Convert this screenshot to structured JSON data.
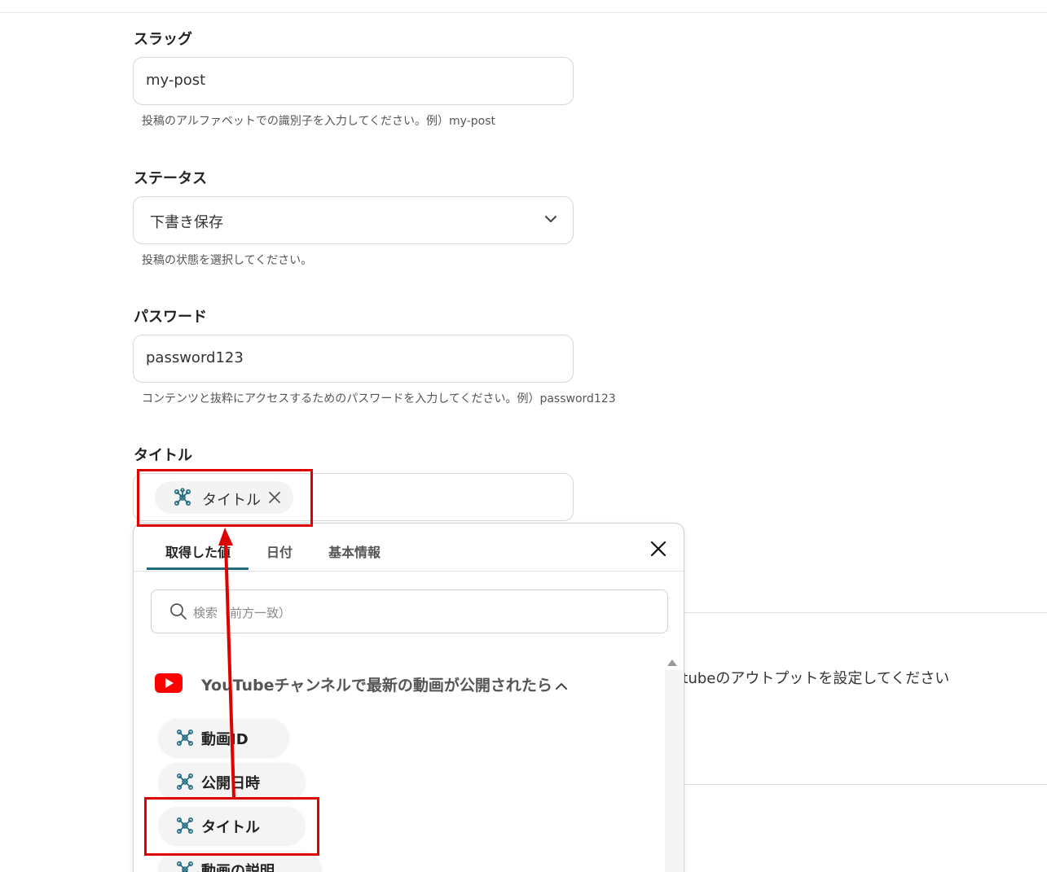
{
  "form": {
    "slug": {
      "label": "スラッグ",
      "value": "my-post",
      "helper": "投稿のアルファベットでの識別子を入力してください。例）my-post"
    },
    "status": {
      "label": "ステータス",
      "value": "下書き保存",
      "helper": "投稿の状態を選択してください。"
    },
    "password": {
      "label": "パスワード",
      "value": "password123",
      "helper": "コンテンツと抜粋にアクセスするためのパスワードを入力してください。例）password123"
    },
    "title": {
      "label": "タイトル",
      "chip": "タイトル"
    }
  },
  "picker": {
    "tabs": [
      "取得した値",
      "日付",
      "基本情報"
    ],
    "active_tab": "取得した値",
    "search_placeholder": "検索（前方一致）",
    "section": "YouTubeチャンネルで最新の動画が公開されたら",
    "items": [
      "動画ID",
      "公開日時",
      "タイトル",
      "動画の説明"
    ]
  },
  "background": {
    "partial_text": "utubeのアウトプットを設定してください"
  },
  "colors": {
    "highlight": "#e00000",
    "tab_accent": "#1f6b82",
    "youtube": "#ff0000",
    "node_icon": "#1f6b82"
  }
}
